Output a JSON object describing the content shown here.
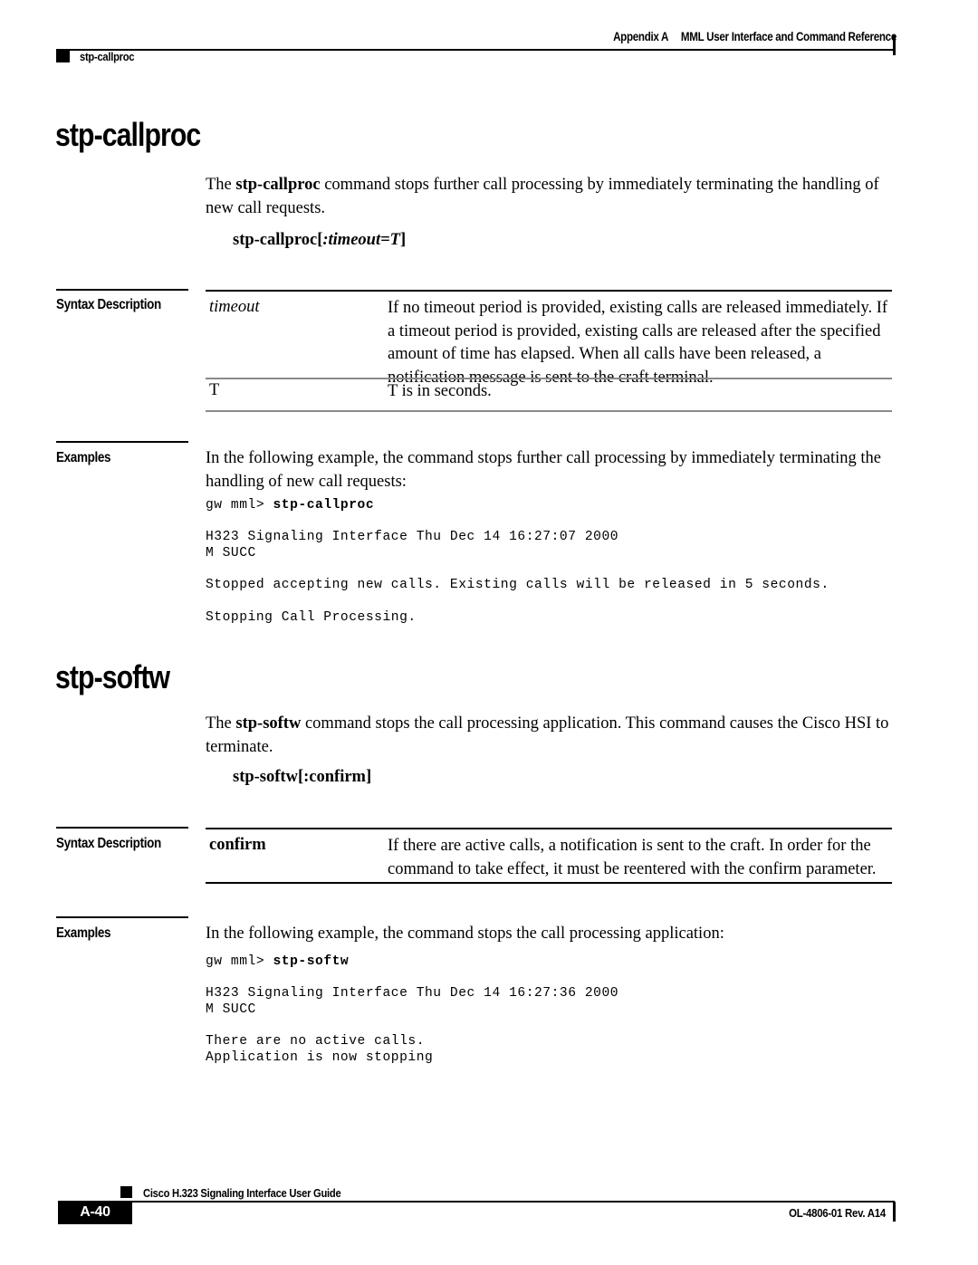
{
  "header": {
    "appendix_label": "Appendix A",
    "appendix_title": "MML User Interface and Command Reference",
    "running_head_left": "stp-callproc"
  },
  "sections": [
    {
      "title": "stp-callproc",
      "intro_prefix": "The ",
      "intro_command": "stp-callproc",
      "intro_suffix": " command stops further call processing by immediately terminating the handling of new call requests.",
      "syntax_command": "stp-callproc",
      "syntax_open": "[",
      "syntax_param": ":timeout=",
      "syntax_value": "T",
      "syntax_close": "]",
      "syntax_description_label": "Syntax Description",
      "syntax_rows": [
        {
          "term": "timeout",
          "description": "If no timeout period is provided, existing calls are released immediately. If a timeout period is provided, existing calls are released after the specified amount of time has elapsed. When all calls have been released, a notification message is sent to the craft terminal."
        },
        {
          "term": "T",
          "description": "T is in seconds."
        }
      ],
      "examples_label": "Examples",
      "examples_intro": "In the following example, the command stops further call processing by immediately terminating the handling of new call requests:",
      "code_prompt": "gw mml> ",
      "code_command": "stp-callproc",
      "code_block_1": "H323 Signaling Interface Thu Dec 14 16:27:07 2000\nM SUCC",
      "code_block_2": "Stopped accepting new calls. Existing calls will be released in 5 seconds.",
      "code_block_3": "Stopping Call Processing."
    },
    {
      "title": "stp-softw",
      "intro_prefix": "The ",
      "intro_command": "stp-softw",
      "intro_suffix": " command stops the call processing application. This command causes the Cisco HSI to terminate.",
      "syntax_command": "stp-softw",
      "syntax_open": "[",
      "syntax_param": ":confirm",
      "syntax_value": "",
      "syntax_close": "]",
      "syntax_description_label": "Syntax Description",
      "syntax_rows": [
        {
          "term": "confirm",
          "description": "If there are active calls, a notification is sent to the craft. In order for the command to take effect, it must be reentered with the confirm parameter."
        }
      ],
      "examples_label": "Examples",
      "examples_intro": "In the following example, the command stops the call processing application:",
      "code_prompt": "gw mml> ",
      "code_command": "stp-softw",
      "code_block_1": "H323 Signaling Interface Thu Dec 14 16:27:36 2000\nM SUCC",
      "code_block_2": "There are no active calls.\nApplication is now stopping"
    }
  ],
  "footer": {
    "guide_title": "Cisco H.323 Signaling Interface User Guide",
    "page_number": "A-40",
    "doc_id": "OL-4806-01 Rev. A14"
  }
}
